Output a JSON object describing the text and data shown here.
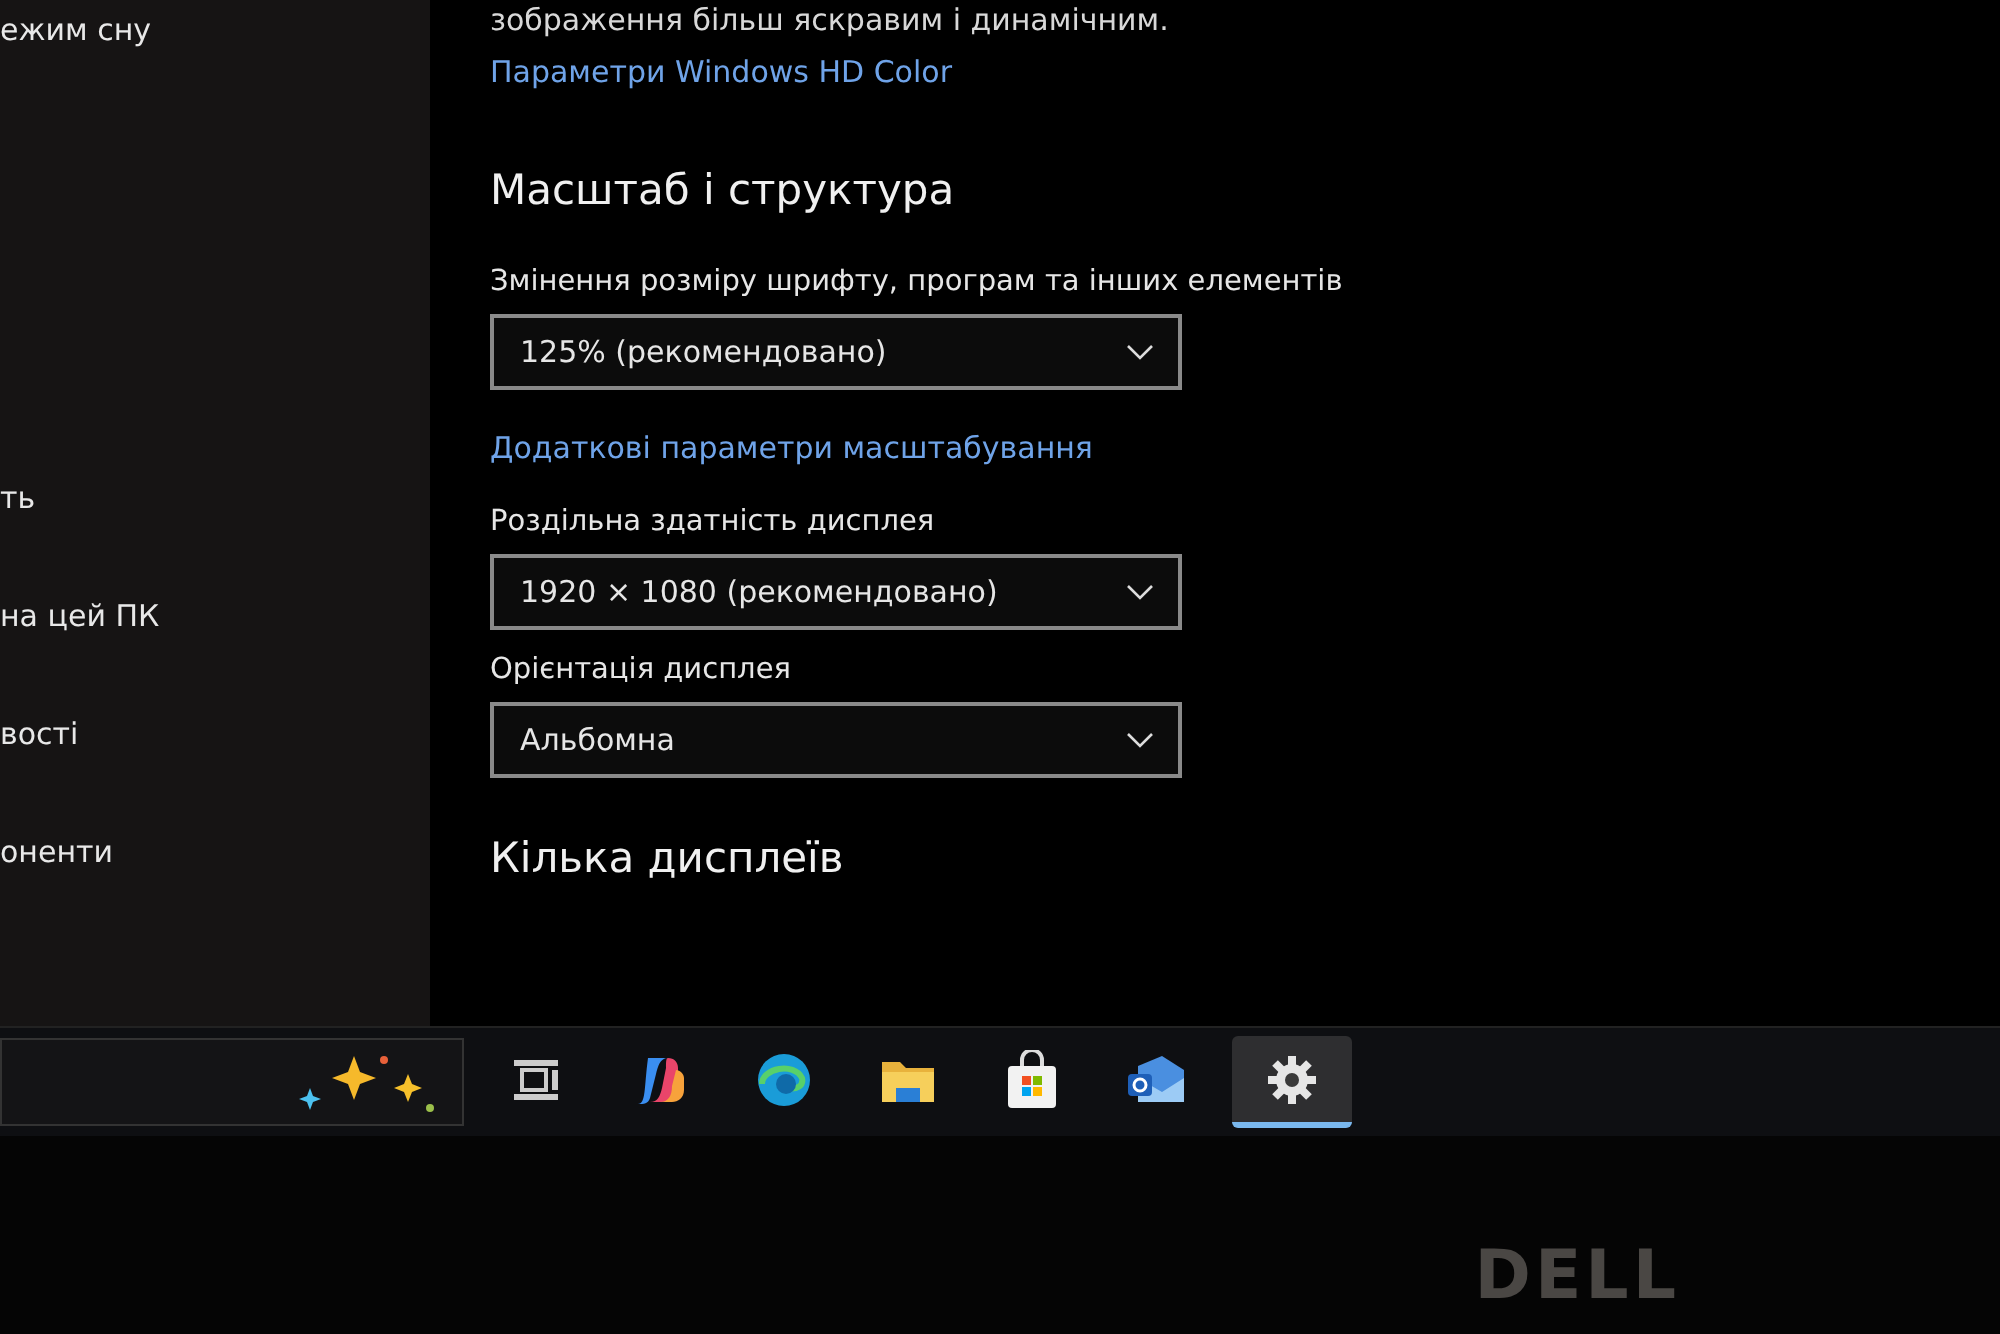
{
  "sidebar": {
    "items": [
      {
        "label": "ежим сну"
      },
      {
        "label": "ть"
      },
      {
        "label": "на цей ПК"
      },
      {
        "label": "вості"
      },
      {
        "label": "оненти"
      }
    ]
  },
  "content": {
    "intro_text": "зображення більш яскравим і динамічним.",
    "hd_link": "Параметри Windows HD Color",
    "section_title": "Масштаб і структура",
    "settings": [
      {
        "label": "Змінення розміру шрифту, програм та інших елементів",
        "value": "125% (рекомендовано)",
        "link": "Додаткові параметри масштабування"
      },
      {
        "label": "Роздільна здатність дисплея",
        "value": "1920 × 1080 (рекомендовано)"
      },
      {
        "label": "Орієнтація дисплея",
        "value": "Альбомна"
      }
    ],
    "next_section_title": "Кілька дисплеїв"
  },
  "taskbar": {
    "items": [
      {
        "kind": "taskview",
        "selected": false
      },
      {
        "kind": "copilot",
        "selected": false
      },
      {
        "kind": "browser",
        "selected": false
      },
      {
        "kind": "folder",
        "selected": false
      },
      {
        "kind": "store",
        "selected": false
      },
      {
        "kind": "mail",
        "selected": false
      },
      {
        "kind": "settings",
        "selected": true
      }
    ]
  },
  "bezel_logo": "DELL"
}
